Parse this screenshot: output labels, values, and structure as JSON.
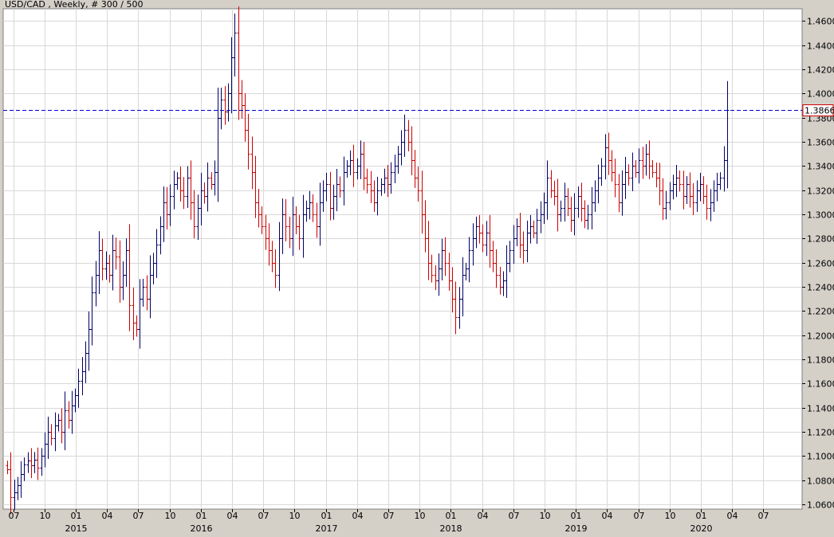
{
  "chart_data": {
    "type": "ohlc",
    "title": "USD/CAD , Weekly, # 300 / 500",
    "xlabel": "",
    "ylabel": "",
    "ylim": [
      1.056,
      1.47
    ],
    "y_ticks": [
      "1.0600",
      "1.0800",
      "1.1000",
      "1.1200",
      "1.1400",
      "1.1600",
      "1.1800",
      "1.2000",
      "1.2200",
      "1.2400",
      "1.2600",
      "1.2800",
      "1.3000",
      "1.3200",
      "1.3400",
      "1.3600",
      "1.3800",
      "1.4000",
      "1.4200",
      "1.4400",
      "1.4600"
    ],
    "month_ticks": [
      "07",
      "10",
      "01",
      "04",
      "07",
      "10",
      "01",
      "04",
      "07",
      "10",
      "01",
      "04",
      "07",
      "10",
      "01",
      "04",
      "07",
      "10",
      "01",
      "04",
      "07",
      "10",
      "01",
      "04",
      "07"
    ],
    "year_labels": [
      "2015",
      "2016",
      "2017",
      "2018",
      "2019",
      "2020"
    ],
    "current_price": 1.3866,
    "current_price_label": "1.3866",
    "colors": {
      "background": "#ffffff",
      "frame": "#d4d0c8",
      "grid": "#d8d8d8",
      "up_bar": "#000066",
      "down_bar": "#cc0000",
      "price_line": "#0000cc"
    },
    "closes": [
      1.089,
      1.066,
      1.07,
      1.076,
      1.085,
      1.093,
      1.096,
      1.092,
      1.097,
      1.09,
      1.1,
      1.11,
      1.12,
      1.115,
      1.125,
      1.13,
      1.12,
      1.138,
      1.13,
      1.142,
      1.15,
      1.162,
      1.17,
      1.185,
      1.205,
      1.235,
      1.25,
      1.27,
      1.255,
      1.26,
      1.25,
      1.27,
      1.265,
      1.24,
      1.25,
      1.27,
      1.225,
      1.21,
      1.205,
      1.23,
      1.24,
      1.23,
      1.25,
      1.26,
      1.275,
      1.29,
      1.31,
      1.3,
      1.315,
      1.325,
      1.33,
      1.32,
      1.315,
      1.33,
      1.31,
      1.29,
      1.305,
      1.32,
      1.315,
      1.33,
      1.325,
      1.335,
      1.38,
      1.395,
      1.385,
      1.4,
      1.43,
      1.45,
      1.4,
      1.39,
      1.37,
      1.35,
      1.335,
      1.31,
      1.3,
      1.29,
      1.28,
      1.27,
      1.26,
      1.25,
      1.28,
      1.3,
      1.29,
      1.28,
      1.3,
      1.29,
      1.28,
      1.3,
      1.305,
      1.31,
      1.3,
      1.29,
      1.31,
      1.32,
      1.325,
      1.305,
      1.315,
      1.325,
      1.32,
      1.335,
      1.34,
      1.345,
      1.335,
      1.34,
      1.35,
      1.33,
      1.325,
      1.32,
      1.31,
      1.32,
      1.325,
      1.33,
      1.325,
      1.335,
      1.34,
      1.35,
      1.36,
      1.37,
      1.36,
      1.345,
      1.33,
      1.32,
      1.3,
      1.28,
      1.26,
      1.25,
      1.245,
      1.255,
      1.27,
      1.26,
      1.245,
      1.23,
      1.215,
      1.23,
      1.25,
      1.255,
      1.27,
      1.28,
      1.29,
      1.285,
      1.275,
      1.285,
      1.27,
      1.26,
      1.25,
      1.24,
      1.245,
      1.26,
      1.27,
      1.28,
      1.29,
      1.275,
      1.27,
      1.285,
      1.29,
      1.285,
      1.295,
      1.3,
      1.31,
      1.33,
      1.32,
      1.315,
      1.3,
      1.305,
      1.315,
      1.305,
      1.295,
      1.305,
      1.315,
      1.305,
      1.295,
      1.3,
      1.31,
      1.32,
      1.33,
      1.34,
      1.355,
      1.345,
      1.335,
      1.325,
      1.31,
      1.325,
      1.335,
      1.33,
      1.34,
      1.335,
      1.345,
      1.34,
      1.35,
      1.34,
      1.335,
      1.33,
      1.32,
      1.305,
      1.31,
      1.32,
      1.325,
      1.33,
      1.325,
      1.315,
      1.325,
      1.315,
      1.31,
      1.32,
      1.325,
      1.315,
      1.305,
      1.31,
      1.32,
      1.325,
      1.33,
      1.345,
      1.3866
    ]
  }
}
